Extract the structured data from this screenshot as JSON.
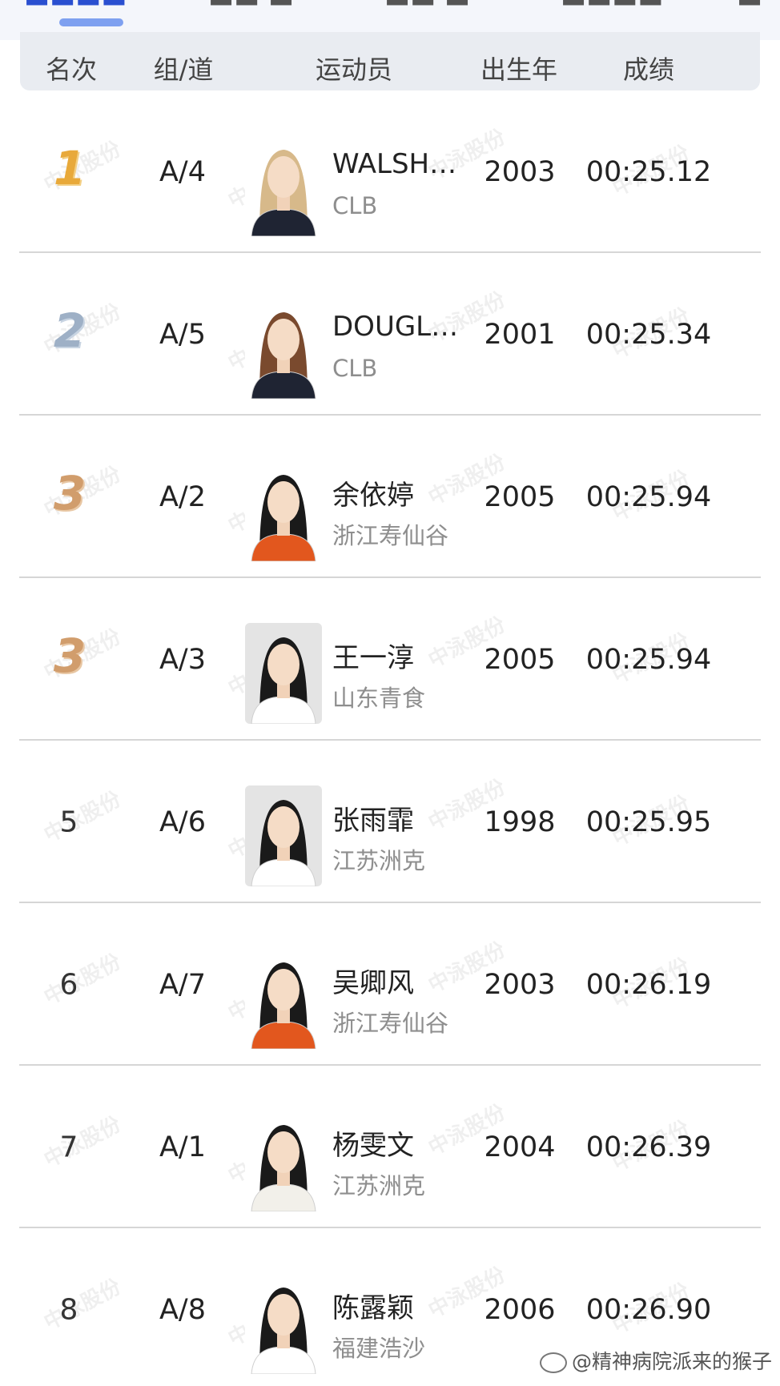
{
  "header": {
    "rank": "名次",
    "group_lane": "组/道",
    "athlete": "运动员",
    "birth_year": "出生年",
    "result": "成绩"
  },
  "rows": [
    {
      "rank": "1",
      "medal": "gold",
      "lane": "A/4",
      "name": "WALSH…",
      "team": "CLB",
      "year": "2003",
      "result": "00:25.12",
      "hair": "#d7b98a",
      "shirt": "#1f2433",
      "bg": "#ffffff"
    },
    {
      "rank": "2",
      "medal": "silver",
      "lane": "A/5",
      "name": "DOUGL…",
      "team": "CLB",
      "year": "2001",
      "result": "00:25.34",
      "hair": "#7a4a2e",
      "shirt": "#1f2433",
      "bg": "#ffffff"
    },
    {
      "rank": "3",
      "medal": "bronze",
      "lane": "A/2",
      "name": "余依婷",
      "team": "浙江寿仙谷",
      "year": "2005",
      "result": "00:25.94",
      "hair": "#1a1a1a",
      "shirt": "#e2571e",
      "bg": "#ffffff"
    },
    {
      "rank": "3",
      "medal": "bronze",
      "lane": "A/3",
      "name": "王一淳",
      "team": "山东青食",
      "year": "2005",
      "result": "00:25.94",
      "hair": "#1a1a1a",
      "shirt": "#ffffff",
      "bg": "#e4e4e4"
    },
    {
      "rank": "5",
      "medal": "",
      "lane": "A/6",
      "name": "张雨霏",
      "team": "江苏洲克",
      "year": "1998",
      "result": "00:25.95",
      "hair": "#1a1a1a",
      "shirt": "#ffffff",
      "bg": "#e4e4e4"
    },
    {
      "rank": "6",
      "medal": "",
      "lane": "A/7",
      "name": "吴卿风",
      "team": "浙江寿仙谷",
      "year": "2003",
      "result": "00:26.19",
      "hair": "#1a1a1a",
      "shirt": "#e2571e",
      "bg": "#ffffff"
    },
    {
      "rank": "7",
      "medal": "",
      "lane": "A/1",
      "name": "杨雯文",
      "team": "江苏洲克",
      "year": "2004",
      "result": "00:26.39",
      "hair": "#1a1a1a",
      "shirt": "#f2f0ea",
      "bg": "#ffffff"
    },
    {
      "rank": "8",
      "medal": "",
      "lane": "A/8",
      "name": "陈露颖",
      "team": "福建浩沙",
      "year": "2006",
      "result": "00:26.90",
      "hair": "#1a1a1a",
      "shirt": "#ffffff",
      "bg": "#ffffff"
    }
  ],
  "watermark": "中泳股份",
  "credit": "@精神病院派来的猴子",
  "colors": {
    "accent": "#2a4fd0",
    "header_bg": "#e9ecf1",
    "gold": "#e8a93a",
    "silver": "#9eb0c6",
    "bronze": "#d19d6c"
  }
}
